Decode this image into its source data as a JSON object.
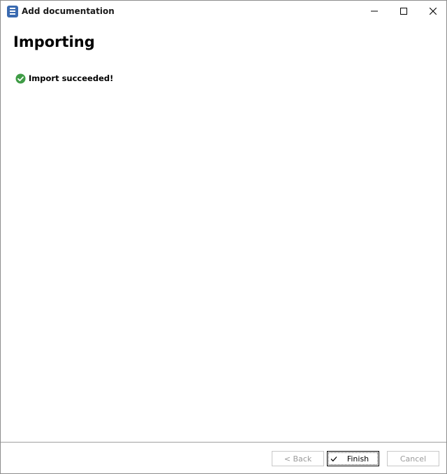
{
  "window": {
    "title": "Add documentation",
    "app_icon": "document-stack-icon",
    "controls": {
      "minimize_icon": "minimize-icon",
      "maximize_icon": "maximize-icon",
      "close_icon": "close-icon"
    }
  },
  "content": {
    "heading": "Importing",
    "status": {
      "icon": "check-circle-icon",
      "icon_color": "#3f9c46",
      "text": "Import succeeded!"
    }
  },
  "footer": {
    "back_label": "< Back",
    "finish_label": "Finish",
    "cancel_label": "Cancel",
    "finish_icon": "checkmark-icon"
  },
  "colors": {
    "app_icon": "#3a6ab0",
    "disabled_text": "#9a9a9a"
  }
}
